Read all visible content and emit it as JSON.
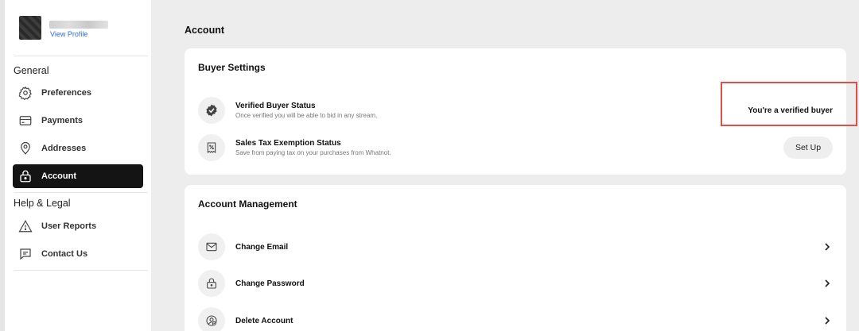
{
  "profile": {
    "view_profile": "View Profile"
  },
  "sidebar": {
    "general_title": "General",
    "general_items": [
      {
        "label": "Preferences",
        "icon": "gear-icon"
      },
      {
        "label": "Payments",
        "icon": "card-icon"
      },
      {
        "label": "Addresses",
        "icon": "location-pin-icon"
      },
      {
        "label": "Account",
        "icon": "lock-icon",
        "active": true
      }
    ],
    "help_title": "Help & Legal",
    "help_items": [
      {
        "label": "User Reports",
        "icon": "warning-icon"
      },
      {
        "label": "Contact Us",
        "icon": "message-icon"
      }
    ]
  },
  "main": {
    "title": "Account",
    "buyer_settings": {
      "title": "Buyer Settings",
      "verified": {
        "title": "Verified Buyer Status",
        "subtitle": "Once verified you will be able to bid in any stream.",
        "status": "You're a verified buyer"
      },
      "tax": {
        "title": "Sales Tax Exemption Status",
        "subtitle": "Save from paying tax on your purchases from Whatnot.",
        "button": "Set Up"
      }
    },
    "account_management": {
      "title": "Account Management",
      "items": [
        {
          "label": "Change Email",
          "icon": "envelope-icon"
        },
        {
          "label": "Change Password",
          "icon": "lock-icon"
        },
        {
          "label": "Delete Account",
          "icon": "delete-user-icon"
        }
      ]
    }
  },
  "colors": {
    "accent_active": "#141414",
    "link": "#2b6fd6",
    "highlight": "#e0504a"
  }
}
